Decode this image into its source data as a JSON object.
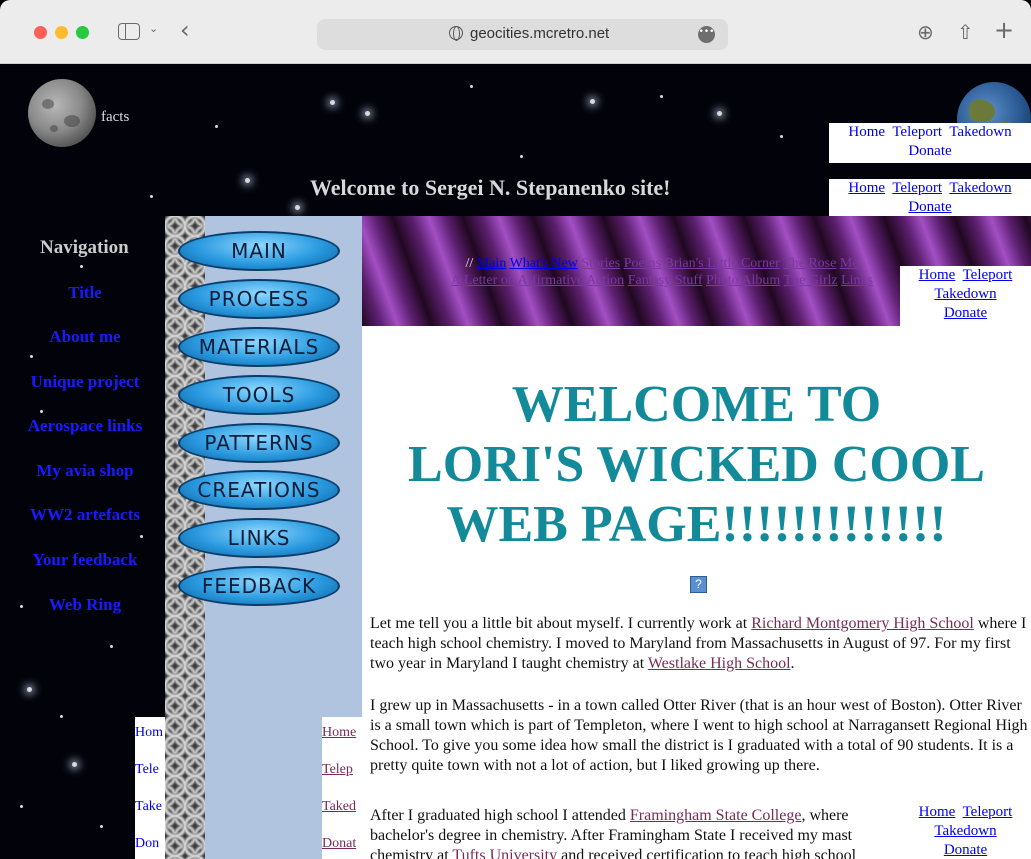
{
  "browser": {
    "url": "geocities.mcretro.net"
  },
  "header": {
    "moon_caption": "facts",
    "site_title": "Welcome to Sergei N. Stepanenko site!"
  },
  "navbox": {
    "home": "Home",
    "teleport": "Teleport",
    "takedown": "Takedown",
    "donate": "Donate"
  },
  "left_nav": {
    "heading": "Navigation",
    "items": [
      "Title",
      "About me",
      "Unique project",
      "Aerospace links",
      "My avia shop",
      "WW2 artefacts",
      "Your feedback",
      "Web Ring"
    ]
  },
  "chain_buttons": [
    "MAIN",
    "PROCESS",
    "MATERIALS",
    "TOOLS",
    "PATTERNS",
    "CREATIONS",
    "LINKS",
    "FEEDBACK"
  ],
  "clipped_boxes": {
    "left": [
      "Hom",
      "Tele",
      "Take",
      "Don"
    ],
    "right": [
      "Home",
      "Telep",
      "Taked",
      "Donat"
    ]
  },
  "top_links": {
    "separator": "//",
    "items": [
      "Main",
      "What's New",
      "Stories",
      "Poems",
      "Brian's Little Corner",
      "The Rose",
      "Me",
      "A Letter on Affirmative Action",
      "Fantasy Stuff",
      "Photo Album",
      "The Girlz",
      "Links"
    ]
  },
  "main": {
    "title_line1": "WELCOME TO",
    "title_line2": "LORI'S WICKED COOL",
    "title_line3": "WEB PAGE!!!!!!!!!!!!!",
    "image_placeholder": "?",
    "p1_a": "Let me tell you a little bit about myself. I currently work at ",
    "p1_link1": "Richard Montgomery High School",
    "p1_b": " where I teach high school chemistry. I moved to Maryland from Massachusetts in August of 97. For my first two year in Maryland I taught chemistry at ",
    "p1_link2": "Westlake High School",
    "p1_c": ".",
    "p2": "I grew up in Massachusetts - in a town called Otter River (that is an hour west of Boston). Otter River is a small town which is part of Templeton, where I went to high school at Narragansett Regional High School. To give you some idea how small the district is I graduated with a total of 90 students. It is a pretty quite town with not a lot of action, but I liked growing up there.",
    "p3_a": "After I graduated high school I attended ",
    "p3_link1": "Framingham State College",
    "p3_b": ", where",
    "p3_c": "bachelor's degree in chemistry. After Framingham State I received my mast",
    "p3_d": "chemistry at ",
    "p3_link2": "Tufts University",
    "p3_e": " and received certification to teach high school"
  }
}
